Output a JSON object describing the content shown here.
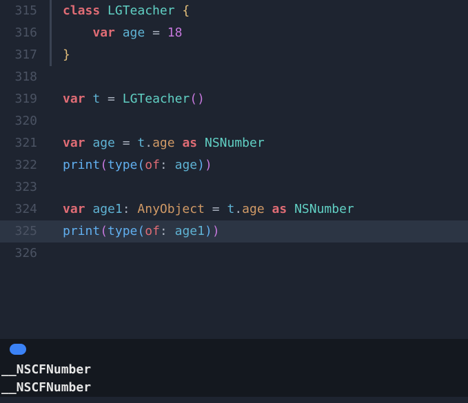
{
  "lines": [
    {
      "num": "315",
      "border": true,
      "highlighted": false,
      "content": [
        {
          "cls": "kw",
          "t": "class"
        },
        {
          "cls": "",
          "t": " "
        },
        {
          "cls": "cls",
          "t": "LGTeacher"
        },
        {
          "cls": "",
          "t": " "
        },
        {
          "cls": "brace",
          "t": "{"
        }
      ]
    },
    {
      "num": "316",
      "border": true,
      "highlighted": false,
      "content": [
        {
          "cls": "",
          "t": "    "
        },
        {
          "cls": "kw",
          "t": "var"
        },
        {
          "cls": "",
          "t": " "
        },
        {
          "cls": "varname",
          "t": "age"
        },
        {
          "cls": "",
          "t": " "
        },
        {
          "cls": "op",
          "t": "="
        },
        {
          "cls": "",
          "t": " "
        },
        {
          "cls": "num",
          "t": "18"
        }
      ]
    },
    {
      "num": "317",
      "border": true,
      "highlighted": false,
      "content": [
        {
          "cls": "brace",
          "t": "}"
        }
      ]
    },
    {
      "num": "318",
      "border": false,
      "highlighted": false,
      "content": []
    },
    {
      "num": "319",
      "border": false,
      "highlighted": false,
      "content": [
        {
          "cls": "kw",
          "t": "var"
        },
        {
          "cls": "",
          "t": " "
        },
        {
          "cls": "varname",
          "t": "t"
        },
        {
          "cls": "",
          "t": " "
        },
        {
          "cls": "op",
          "t": "="
        },
        {
          "cls": "",
          "t": " "
        },
        {
          "cls": "cls",
          "t": "LGTeacher"
        },
        {
          "cls": "paren",
          "t": "()"
        }
      ]
    },
    {
      "num": "320",
      "border": false,
      "highlighted": false,
      "content": []
    },
    {
      "num": "321",
      "border": false,
      "highlighted": false,
      "content": [
        {
          "cls": "kw",
          "t": "var"
        },
        {
          "cls": "",
          "t": " "
        },
        {
          "cls": "varname",
          "t": "age"
        },
        {
          "cls": "",
          "t": " "
        },
        {
          "cls": "op",
          "t": "="
        },
        {
          "cls": "",
          "t": " "
        },
        {
          "cls": "varname",
          "t": "t"
        },
        {
          "cls": "punct",
          "t": "."
        },
        {
          "cls": "dotprop",
          "t": "age"
        },
        {
          "cls": "",
          "t": " "
        },
        {
          "cls": "kw",
          "t": "as"
        },
        {
          "cls": "",
          "t": " "
        },
        {
          "cls": "type",
          "t": "NSNumber"
        }
      ]
    },
    {
      "num": "322",
      "border": false,
      "highlighted": false,
      "content": [
        {
          "cls": "func",
          "t": "print"
        },
        {
          "cls": "paren",
          "t": "("
        },
        {
          "cls": "func",
          "t": "type"
        },
        {
          "cls": "paren2",
          "t": "("
        },
        {
          "cls": "of",
          "t": "of"
        },
        {
          "cls": "punct",
          "t": ": "
        },
        {
          "cls": "varname",
          "t": "age"
        },
        {
          "cls": "paren2",
          "t": ")"
        },
        {
          "cls": "paren",
          "t": ")"
        }
      ]
    },
    {
      "num": "323",
      "border": false,
      "highlighted": false,
      "content": []
    },
    {
      "num": "324",
      "border": false,
      "highlighted": false,
      "content": [
        {
          "cls": "kw",
          "t": "var"
        },
        {
          "cls": "",
          "t": " "
        },
        {
          "cls": "varname",
          "t": "age1"
        },
        {
          "cls": "punct",
          "t": ": "
        },
        {
          "cls": "typearg",
          "t": "AnyObject"
        },
        {
          "cls": "",
          "t": " "
        },
        {
          "cls": "op",
          "t": "="
        },
        {
          "cls": "",
          "t": " "
        },
        {
          "cls": "varname",
          "t": "t"
        },
        {
          "cls": "punct",
          "t": "."
        },
        {
          "cls": "dotprop",
          "t": "age"
        },
        {
          "cls": "",
          "t": " "
        },
        {
          "cls": "kw",
          "t": "as"
        },
        {
          "cls": "",
          "t": " "
        },
        {
          "cls": "type",
          "t": "NSNumber"
        }
      ]
    },
    {
      "num": "325",
      "border": false,
      "highlighted": true,
      "content": [
        {
          "cls": "func",
          "t": "print"
        },
        {
          "cls": "paren",
          "t": "("
        },
        {
          "cls": "func",
          "t": "type"
        },
        {
          "cls": "paren2",
          "t": "("
        },
        {
          "cls": "of",
          "t": "of"
        },
        {
          "cls": "punct",
          "t": ": "
        },
        {
          "cls": "varname",
          "t": "age1"
        },
        {
          "cls": "paren2",
          "t": ")"
        },
        {
          "cls": "paren",
          "t": ")"
        }
      ]
    },
    {
      "num": "326",
      "border": false,
      "highlighted": false,
      "content": []
    }
  ],
  "console": {
    "output1": "__NSCFNumber",
    "output2": "__NSCFNumber"
  }
}
